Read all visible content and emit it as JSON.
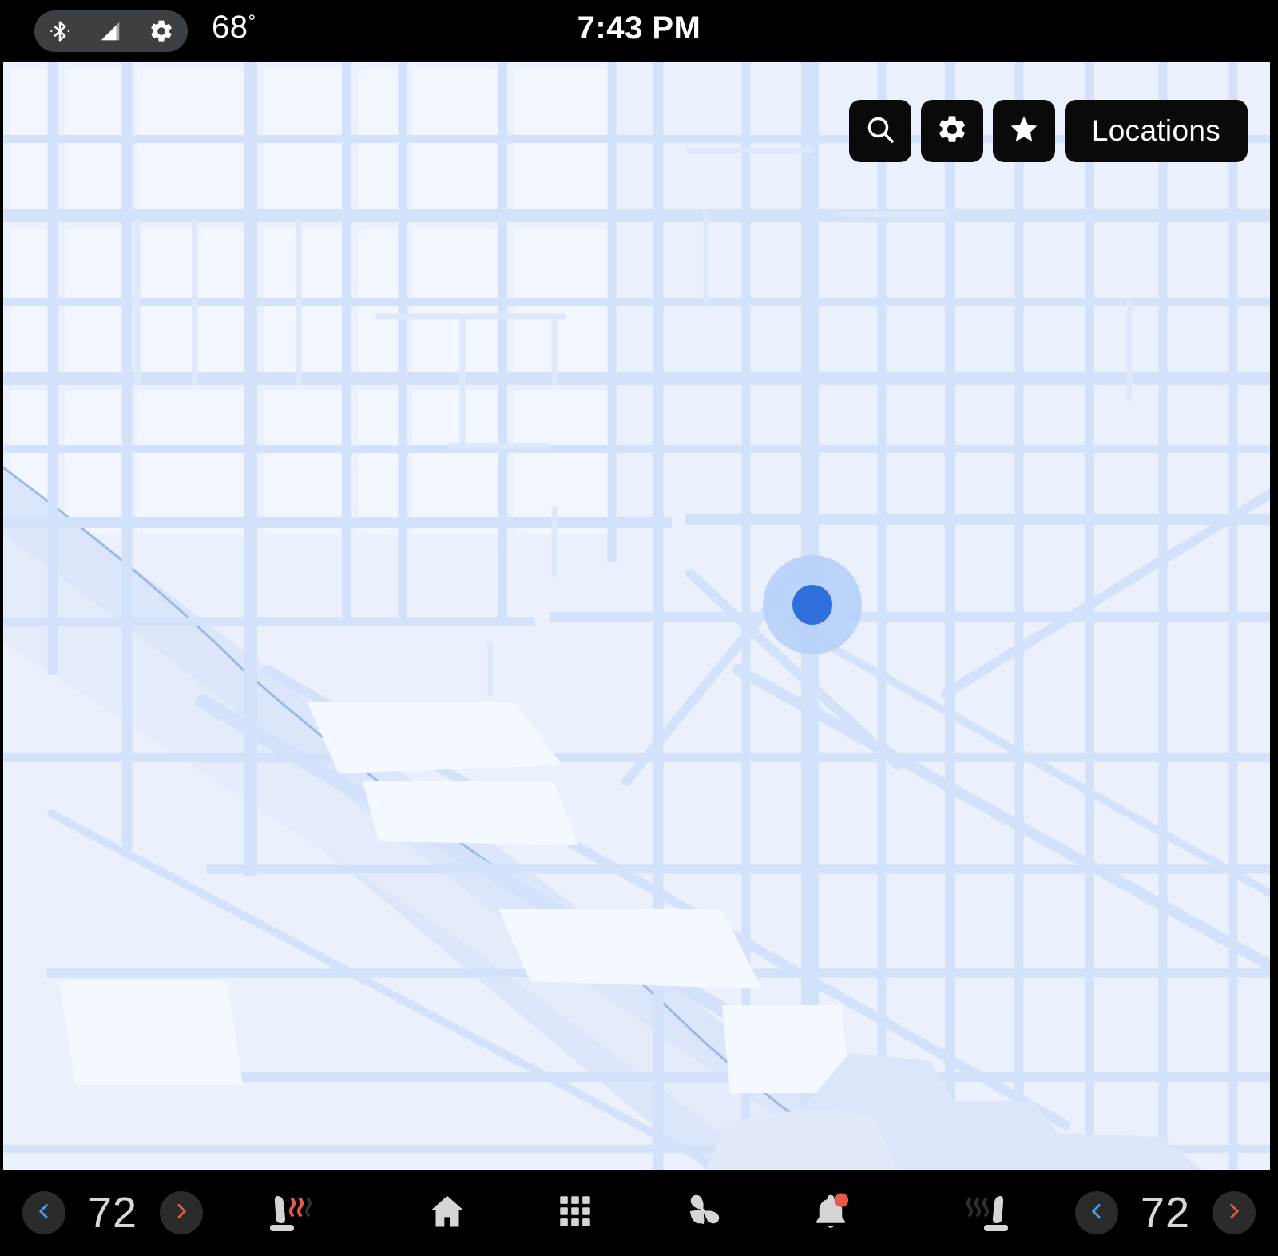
{
  "status_bar": {
    "bluetooth_icon": "bluetooth-icon",
    "signal_icon": "cell-signal-icon",
    "settings_icon": "gear-icon",
    "outside_temp": "68",
    "degree_symbol": "°",
    "clock": "7:43 PM"
  },
  "map": {
    "controls": {
      "search_icon": "search-icon",
      "settings_icon": "gear-icon",
      "favorites_icon": "star-icon",
      "locations_label": "Locations"
    },
    "user_location_marker": "location-puck",
    "colors": {
      "land": "#eaf0fc",
      "block_fill": "#e9effc",
      "road": "#d3e2fa",
      "road_minor": "#dde8fb",
      "water": "#dbe6fb",
      "water_line": "#9ab8ee",
      "puck_dot": "#2f6fdb",
      "puck_halo": "#b4cff8"
    }
  },
  "bottom_bar": {
    "driver_climate": {
      "decrease_icon": "chevron-left-icon",
      "temperature": "72",
      "increase_icon": "chevron-right-icon",
      "decrease_color": "#4d9fe8",
      "increase_color": "#e8594a"
    },
    "driver_seat_heater": {
      "icon": "heated-seat-icon",
      "active": true,
      "active_color": "#e8594a",
      "inactive_color": "#2e2e2e"
    },
    "nav": [
      {
        "icon": "home-icon",
        "label": "Home"
      },
      {
        "icon": "apps-grid-icon",
        "label": "Apps"
      },
      {
        "icon": "fan-icon",
        "label": "Climate"
      },
      {
        "icon": "bell-icon",
        "label": "Notifications",
        "badge": true
      }
    ],
    "passenger_seat_heater": {
      "icon": "heated-seat-icon",
      "active": false,
      "inactive_color": "#2e2e2e"
    },
    "passenger_climate": {
      "decrease_icon": "chevron-left-icon",
      "temperature": "72",
      "increase_icon": "chevron-right-icon",
      "decrease_color": "#4d9fe8",
      "increase_color": "#e8594a"
    },
    "colors": {
      "bar_bg": "#000000",
      "button_bg": "#2b2b2b",
      "icon_gray": "#d5d5d5",
      "badge": "#e8594a"
    }
  }
}
